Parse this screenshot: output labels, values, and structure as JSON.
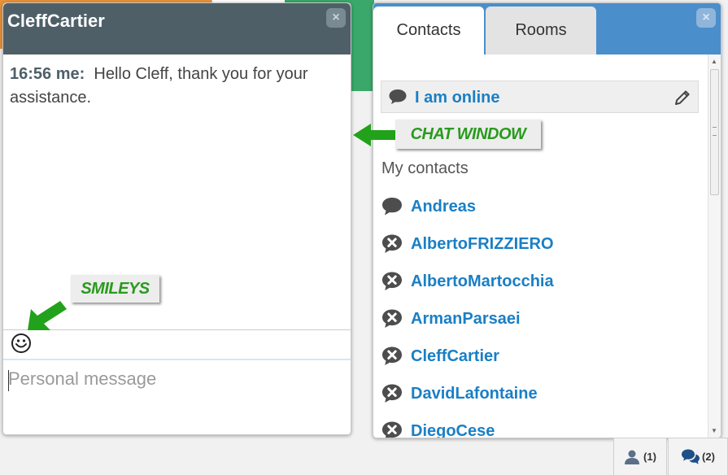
{
  "chat": {
    "title": "CleffCartier",
    "close_label": "×",
    "messages": [
      {
        "time": "16:56 me:",
        "text": "Hello Cleff, thank you for your assistance."
      }
    ],
    "input_placeholder": "Personal message"
  },
  "contacts_panel": {
    "tabs": [
      {
        "label": "Contacts"
      },
      {
        "label": "Rooms"
      }
    ],
    "close_label": "×",
    "status": {
      "text": "I am online",
      "icon": "speech-bubble-icon"
    },
    "my_contacts_label": "My contacts",
    "contacts": [
      {
        "name": "Andreas",
        "status_icon": "speech-bubble-icon"
      },
      {
        "name": "AlbertoFRIZZIERO",
        "status_icon": "offline-x-icon"
      },
      {
        "name": "AlbertoMartocchia",
        "status_icon": "offline-x-icon"
      },
      {
        "name": "ArmanParsaei",
        "status_icon": "offline-x-icon"
      },
      {
        "name": "CleffCartier",
        "status_icon": "offline-x-icon"
      },
      {
        "name": "DavidLafontaine",
        "status_icon": "offline-x-icon"
      },
      {
        "name": "DiegoCese",
        "status_icon": "offline-x-icon"
      }
    ]
  },
  "annotations": {
    "chat_window": "CHAT WINDOW",
    "smileys": "SMILEYS"
  },
  "bottom_bar": {
    "contacts_count": "(1)",
    "rooms_count": "(2)"
  },
  "colors": {
    "chat_header": "#4e5f68",
    "contacts_header": "#4a8ecb",
    "link_blue": "#1a7fc5",
    "callout_green": "#2a9a1e"
  }
}
